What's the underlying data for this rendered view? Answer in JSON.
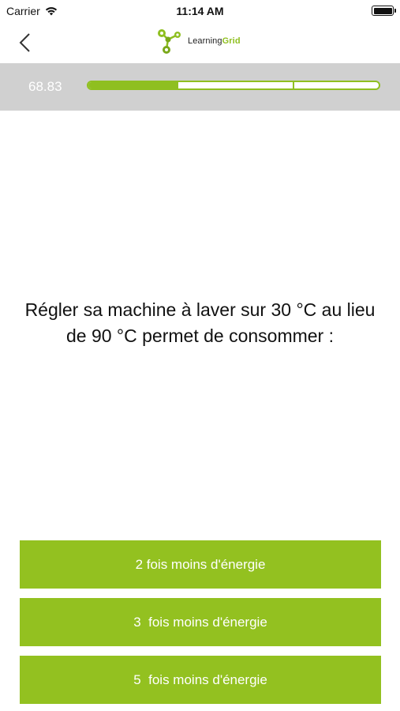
{
  "status_bar": {
    "carrier": "Carrier",
    "time": "11:14 AM",
    "battery_level": 1.0
  },
  "nav": {
    "back_icon": "chevron-left-icon",
    "logo_text_light": "Learning",
    "logo_text_bold": "Grid",
    "logo_icon": "molecule-logo-icon"
  },
  "progress": {
    "score": "68.83",
    "fill_fraction": 0.31,
    "marker_fraction": 0.705,
    "color": "#8fbf20",
    "band_color": "#d0d0d0"
  },
  "question": {
    "text": "Régler sa machine à laver sur 30 °C au lieu de 90 °C permet de consommer :"
  },
  "answers": [
    {
      "label": "2 fois moins d'énergie"
    },
    {
      "label": "3  fois moins d'énergie"
    },
    {
      "label": "5  fois moins d'énergie"
    }
  ],
  "colors": {
    "answer_button": "#93c120",
    "answer_text": "#ffffff"
  }
}
